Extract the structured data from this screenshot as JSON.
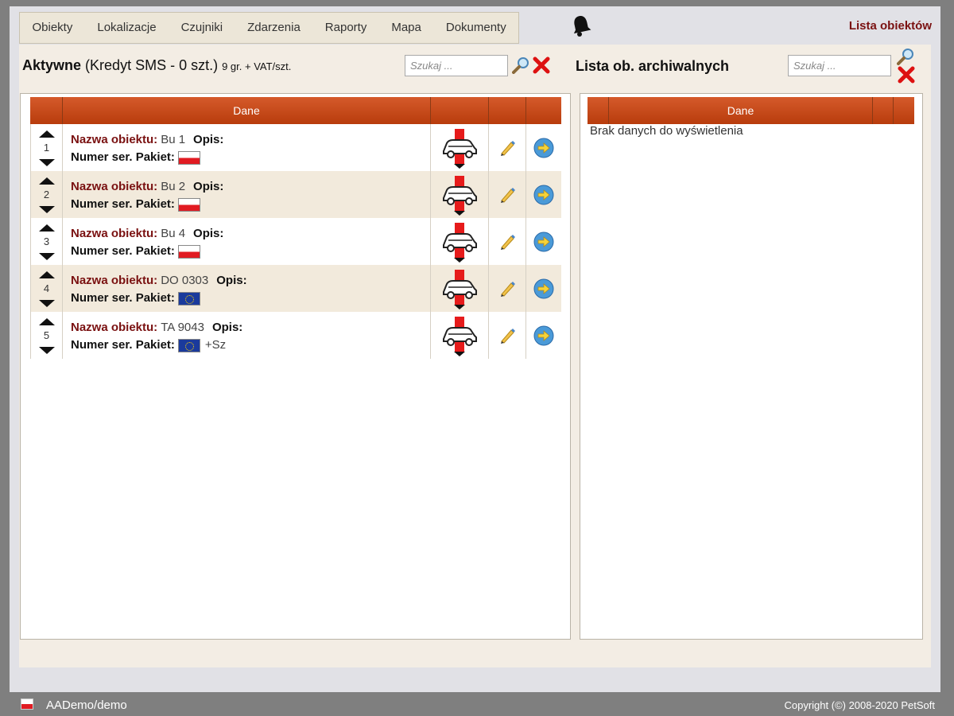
{
  "nav": {
    "items": [
      "Obiekty",
      "Lokalizacje",
      "Czujniki",
      "Zdarzenia",
      "Raporty",
      "Mapa",
      "Dokumenty"
    ]
  },
  "page_heading": "Lista obiektów",
  "active": {
    "title_bold": "Aktywne",
    "title_rest": "(Kredyt SMS - 0 szt.)",
    "title_small": "9 gr. + VAT/szt.",
    "search_placeholder": "Szukaj ...",
    "column_header": "Dane",
    "labels": {
      "name": "Nazwa obiektu:",
      "desc": "Opis:",
      "serial": "Numer ser. Pakiet:"
    },
    "rows": [
      {
        "order": "1",
        "name": "Bu 1",
        "flag": "pl",
        "extra": ""
      },
      {
        "order": "2",
        "name": "Bu 2",
        "flag": "pl",
        "extra": ""
      },
      {
        "order": "3",
        "name": "Bu 4",
        "flag": "pl",
        "extra": ""
      },
      {
        "order": "4",
        "name": "DO 0303",
        "flag": "eu",
        "extra": ""
      },
      {
        "order": "5",
        "name": "TA 9043",
        "flag": "eu",
        "extra": "+Sz"
      }
    ]
  },
  "archive": {
    "title": "Lista ob. archiwalnych",
    "search_placeholder": "Szukaj ...",
    "column_header": "Dane",
    "empty_message": "Brak danych do wyświetlenia"
  },
  "footer": {
    "user": "AADemo/demo",
    "copyright": "Copyright (©) 2008-2020 PetSoft"
  },
  "colors": {
    "header_orange": "#c4471a",
    "dark_red": "#7a1111",
    "row_alt": "#f2eadc"
  }
}
